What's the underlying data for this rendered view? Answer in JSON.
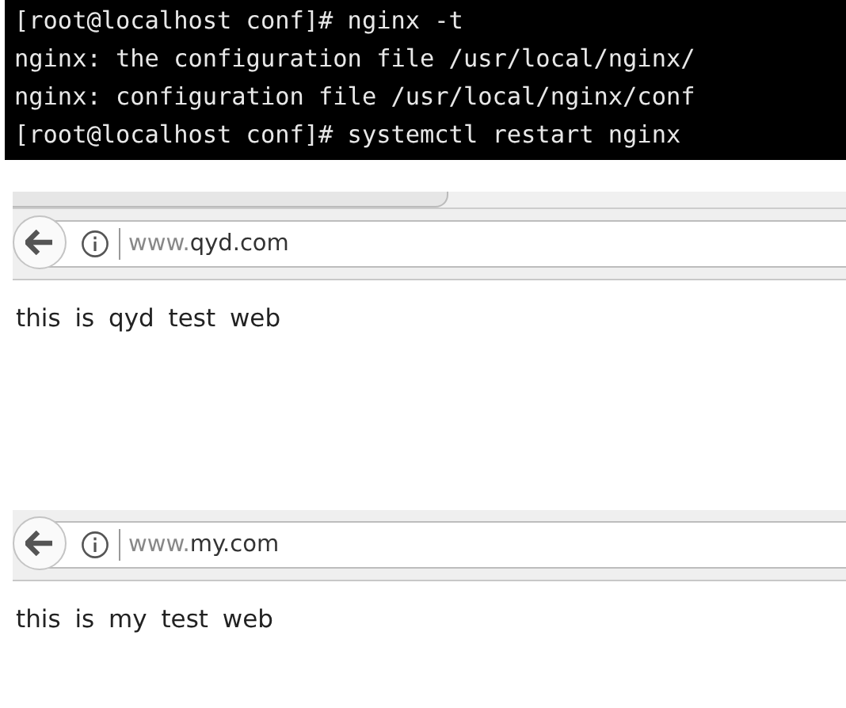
{
  "terminal": {
    "lines": [
      {
        "text": "[root@localhost conf]# nginx -t"
      },
      {
        "text": "nginx: the configuration file /usr/local/nginx/"
      },
      {
        "text": "nginx: configuration file /usr/local/nginx/conf"
      },
      {
        "text": "[root@localhost conf]# systemctl restart nginx"
      }
    ]
  },
  "browsers": [
    {
      "show_tab_strip": true,
      "url_prefix": "www.",
      "url_host": "qyd.com",
      "page_text": "this is qyd test web"
    },
    {
      "show_tab_strip": false,
      "url_prefix": "www.",
      "url_host": "my.com",
      "page_text": "this is my test web"
    }
  ]
}
